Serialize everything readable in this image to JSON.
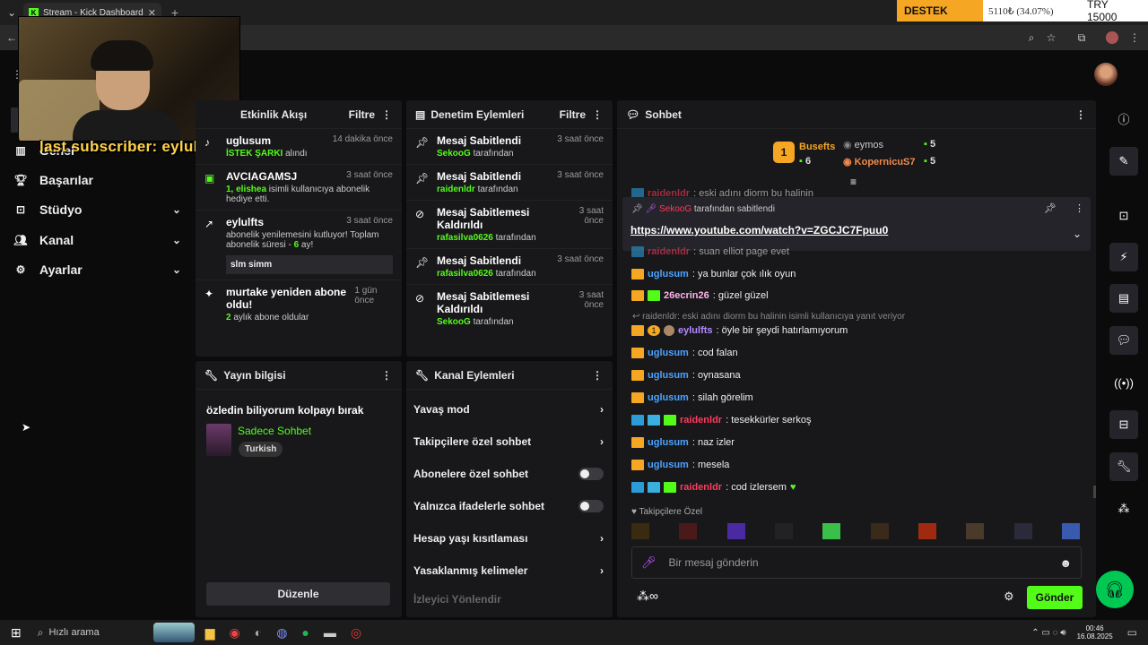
{
  "browser": {
    "tab_title": "Stream - Kick Dashboard",
    "tab_close": "✕",
    "new_tab": "+"
  },
  "ticker": {
    "label": "DESTEK",
    "price": "5110₺ (34.07%)",
    "total": "TRY 15000"
  },
  "overlay": {
    "text": "last subscriber: eylulfts"
  },
  "sidebar": {
    "items": [
      {
        "label": "Genel",
        "icon": "chart-icon"
      },
      {
        "label": "Başarılar",
        "icon": "trophy-icon"
      },
      {
        "label": "Stüdyo",
        "icon": "studio-icon"
      },
      {
        "label": "Kanal",
        "icon": "users-icon"
      },
      {
        "label": "Ayarlar",
        "icon": "gear-icon"
      }
    ]
  },
  "activity": {
    "title": "Etkinlik Akışı",
    "filter": "Filtre",
    "items": [
      {
        "user": "uglusum",
        "time": "14 dakika önce",
        "highlight": "İSTEK ŞARKI",
        "text": " alındı"
      },
      {
        "user": "AVCIAGAMSJ",
        "time": "3 saat önce",
        "highlight": "1, elishea",
        "text": " isimli kullanıcıya abonelik hediye etti."
      },
      {
        "user": "eylulfts",
        "time": "3 saat önce",
        "text": "abonelik yenilemesini kutluyor! Toplam abonelik süresi - ",
        "months": "6",
        "suffix": " ay!",
        "message": "slm simm"
      },
      {
        "user": "murtake yeniden abone oldu!",
        "time": "1 gün önce",
        "highlight": "2",
        "text": " aylık abone oldular"
      }
    ]
  },
  "moderation": {
    "title": "Denetim Eylemleri",
    "filter": "Filtre",
    "items": [
      {
        "title": "Mesaj Sabitlendi",
        "time": "3 saat önce",
        "user": "SekooG",
        "by": " tarafından"
      },
      {
        "title": "Mesaj Sabitlendi",
        "time": "3 saat önce",
        "user": "raidenldr",
        "by": " tarafından"
      },
      {
        "title": "Mesaj Sabitlemesi Kaldırıldı",
        "time": "3 saat önce",
        "user": "rafasilva0626",
        "by": " tarafından"
      },
      {
        "title": "Mesaj Sabitlendi",
        "time": "3 saat önce",
        "user": "rafasilva0626",
        "by": " tarafından"
      },
      {
        "title": "Mesaj Sabitlemesi Kaldırıldı",
        "time": "3 saat önce",
        "user": "SekooG",
        "by": " tarafından"
      }
    ]
  },
  "stream_info": {
    "title": "Yayın bilgisi",
    "stream_title": "özledin biliyorum kolpayı bırak",
    "category": "Sadece Sohbet",
    "language": "Turkish",
    "edit": "Düzenle"
  },
  "channel_actions": {
    "title": "Kanal Eylemleri",
    "rows": [
      {
        "label": "Yavaş mod",
        "kind": "arrow"
      },
      {
        "label": "Takipçilere özel sohbet",
        "kind": "arrow"
      },
      {
        "label": "Abonelere özel sohbet",
        "kind": "toggle"
      },
      {
        "label": "Yalnızca ifadelerle sohbet",
        "kind": "toggle"
      },
      {
        "label": "Hesap yaşı kısıtlaması",
        "kind": "arrow"
      },
      {
        "label": "Yasaklanmış kelimeler",
        "kind": "arrow"
      },
      {
        "label": "İzleyici Yönlendir",
        "kind": "none"
      }
    ]
  },
  "chat": {
    "title": "Sohbet",
    "leaderboard": [
      {
        "name": "Busefts",
        "count": "6",
        "rank": "1"
      },
      {
        "name": "eymos",
        "count": "5"
      },
      {
        "name": "KopernicuS7",
        "count": "5"
      }
    ],
    "pinned": {
      "user": "SekooG",
      "text": " tarafından sabitlendi",
      "link": "https://www.youtube.com/watch?v=ZGCJC7Fpuu0"
    },
    "partial_top": {
      "user": "raidenldr",
      "text": ": eski adını diorm bu halinin"
    },
    "partial_under": {
      "user": "raidenldr",
      "text": ": suan elliot page evet"
    },
    "messages": [
      {
        "user": "uglusum",
        "text": ": ya bunlar çok ılık oyun",
        "color": "blue",
        "badges": "crown"
      },
      {
        "user": "26ecrin26",
        "text": ": güzel güzel",
        "color": "pink",
        "badges": "crown-sub"
      },
      {
        "user": "eylulfts",
        "text": ": öyle bir şeydi hatırlamıyorum",
        "color": "purple",
        "badges": "crown-rank"
      },
      {
        "user": "uglusum",
        "text": ": cod falan",
        "color": "blue",
        "badges": "crown"
      },
      {
        "user": "uglusum",
        "text": ": oynasana",
        "color": "blue",
        "badges": "crown"
      },
      {
        "user": "uglusum",
        "text": ": silah görelim",
        "color": "blue",
        "badges": "crown"
      },
      {
        "user": "raidenldr",
        "text": ": tesekkürler serkoş",
        "color": "red",
        "badges": "vip"
      },
      {
        "user": "uglusum",
        "text": ": naz izler",
        "color": "blue",
        "badges": "crown"
      },
      {
        "user": "uglusum",
        "text": ": mesela",
        "color": "blue",
        "badges": "crown"
      },
      {
        "user": "raidenldr",
        "text": ": cod izlersem",
        "color": "red",
        "badges": "vip",
        "heart": "♥"
      }
    ],
    "reply_context": "raidenldr: eski adını diorm bu halinin isimli kullanıcıya yanıt veriyor",
    "emote_label": "Takipçilere Özel",
    "input_placeholder": "Bir mesaj gönderin",
    "send": "Gönder",
    "points": "∞"
  },
  "taskbar": {
    "search": "Hızlı arama",
    "time": "00:46",
    "date": "16.08.2025"
  }
}
